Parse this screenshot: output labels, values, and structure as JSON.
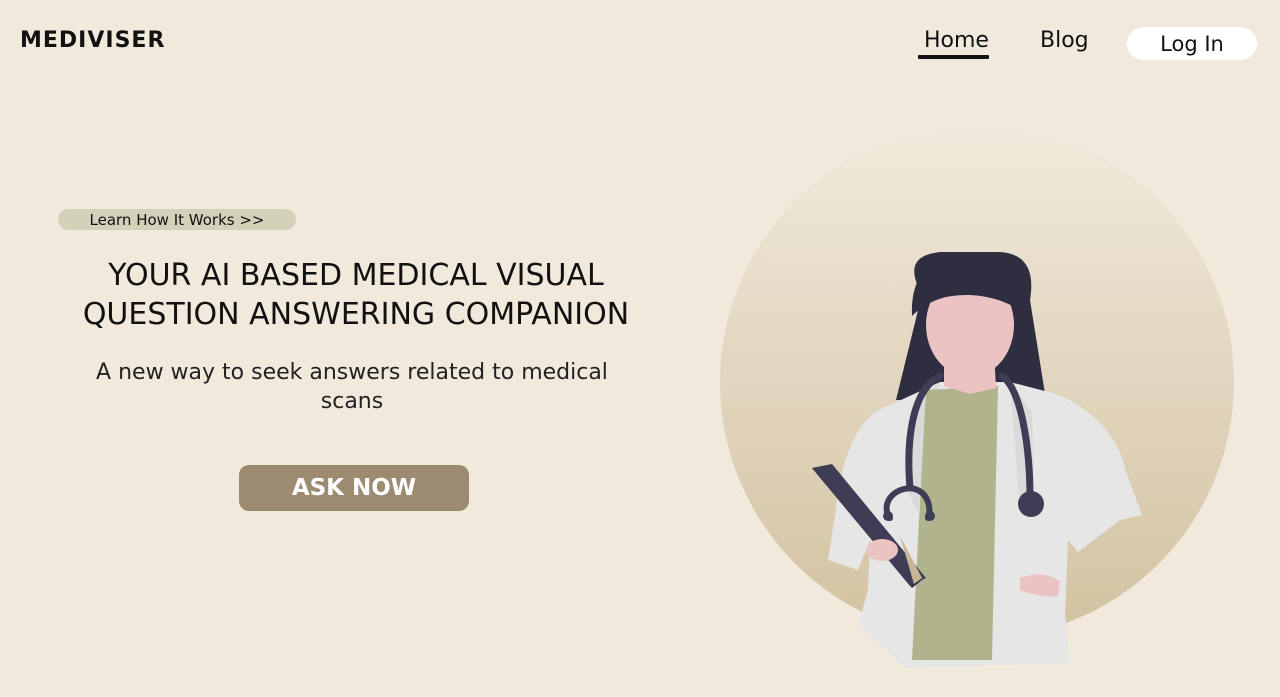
{
  "header": {
    "logo": "MEDIVISER",
    "nav": {
      "home": "Home",
      "blog": "Blog"
    },
    "login_label": "Log In"
  },
  "hero": {
    "learn_label": "Learn How It Works >>",
    "title_line1": "YOUR AI BASED MEDICAL VISUAL",
    "title_line2": "QUESTION ANSWERING COMPANION",
    "subtitle_line1": "A new way to seek answers related to medical",
    "subtitle_line2": "scans",
    "ask_label": "ASK NOW"
  },
  "colors": {
    "background": "#f1e9dc",
    "accent_button": "#9c8b70",
    "pill": "#d4d1bb",
    "circle_light": "#f1e9dc",
    "circle_dark": "#d4c6a6",
    "hair": "#2f2e41",
    "skin": "#ebc3c3",
    "coat": "#e6e6e6",
    "shirt": "#b1b38c"
  },
  "illustration": {
    "icon": "doctor-illustration-icon"
  }
}
